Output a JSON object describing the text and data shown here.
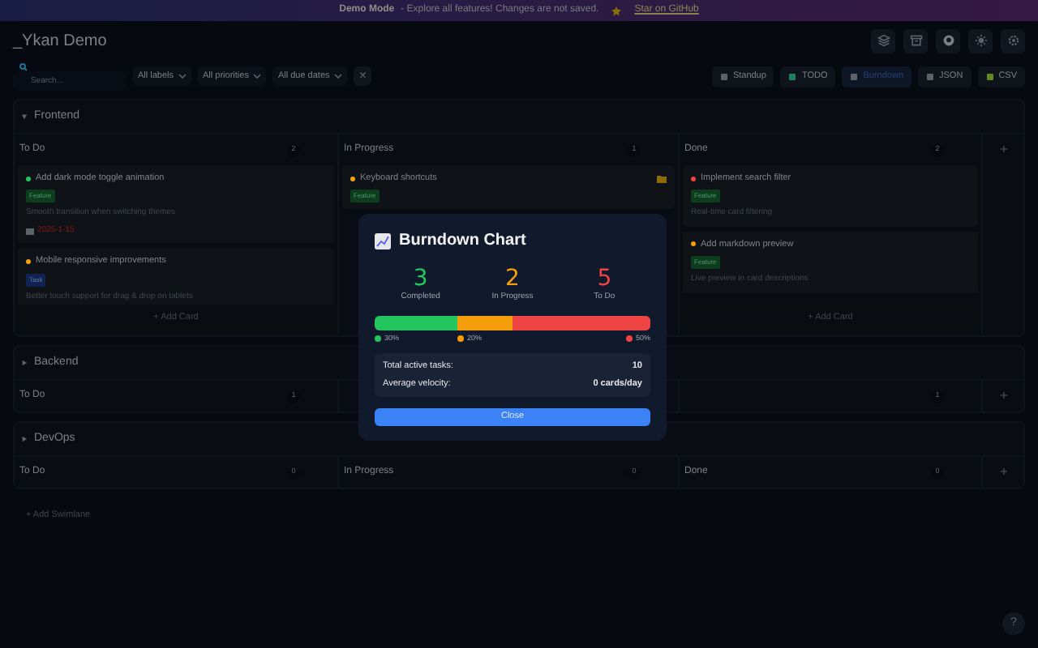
{
  "banner": {
    "title": "Demo Mode",
    "message": "- Explore all features! Changes are not saved.",
    "link": "Star on GitHub"
  },
  "app_title": "_Ykan Demo",
  "toolbar": {
    "search": {
      "placeholder": "Search..."
    },
    "filters": [
      "All labels",
      "All priorities",
      "All due dates"
    ],
    "clear": "×",
    "views": [
      {
        "label": "Standup",
        "selected": false
      },
      {
        "label": "TODO",
        "selected": false
      },
      {
        "label": "Burndown",
        "selected": true
      },
      {
        "label": "JSON",
        "selected": false
      },
      {
        "label": "CSV",
        "selected": false
      }
    ]
  },
  "swimlanes": [
    {
      "name": "Frontend",
      "expanded": true,
      "columns": [
        {
          "label": "To Do",
          "count": "2",
          "add_card": "+ Add Card",
          "cards": [
            {
              "title": "Add dark mode toggle animation",
              "color": "#22c55e",
              "tag": {
                "text": "Feature",
                "kind": "feature"
              },
              "description": "Smooth transition when switching themes",
              "due": "2025-1-15"
            },
            {
              "title": "Mobile responsive improvements",
              "color": "#f59e0b",
              "tag": {
                "text": "Task",
                "kind": "task"
              },
              "description": "Better touch support for drag & drop on tablets"
            }
          ]
        },
        {
          "label": "In Progress",
          "count": "1",
          "cards": [
            {
              "title": "Keyboard shortcuts",
              "color": "#f59e0b",
              "tag": {
                "text": "Feature",
                "kind": "feature"
              },
              "folder": true
            }
          ]
        },
        {
          "label": "Done",
          "count": "2",
          "add_card": "+ Add Card",
          "cards": [
            {
              "title": "Implement search filter",
              "color": "#ef4444",
              "tag": {
                "text": "Feature",
                "kind": "feature"
              },
              "description": "Real-time card filtering"
            },
            {
              "title": "Add markdown preview",
              "color": "#f59e0b",
              "tag": {
                "text": "Feature",
                "kind": "feature"
              },
              "description": "Live preview in card descriptions"
            }
          ]
        }
      ]
    },
    {
      "name": "Backend",
      "expanded": false,
      "columns": [
        {
          "label": "To Do",
          "count": "1"
        },
        {},
        {
          "count": "1"
        }
      ]
    },
    {
      "name": "DevOps",
      "expanded": false,
      "columns": [
        {
          "label": "To Do",
          "count": "0"
        },
        {
          "label": "In Progress",
          "count": "0"
        },
        {
          "label": "Done",
          "count": "0"
        }
      ]
    }
  ],
  "add_swimlane": "+ Add Swimlane",
  "help": "?",
  "modal": {
    "title": "Burndown Chart",
    "stats": [
      {
        "value": "3",
        "label": "Completed",
        "color": "#22c55e"
      },
      {
        "value": "2",
        "label": "In Progress",
        "color": "#f59e0b"
      },
      {
        "value": "5",
        "label": "To Do",
        "color": "#ef4444"
      }
    ],
    "segments": [
      {
        "color": "#22c55e",
        "label": "30%"
      },
      {
        "color": "#f59e0b",
        "label": "20%"
      },
      {
        "color": "#ef4444",
        "label": "50%"
      }
    ],
    "summary": [
      {
        "label": "Total active tasks:",
        "value": "10"
      },
      {
        "label": "Average velocity:",
        "value": "0 cards/day"
      }
    ],
    "close": "Close"
  }
}
